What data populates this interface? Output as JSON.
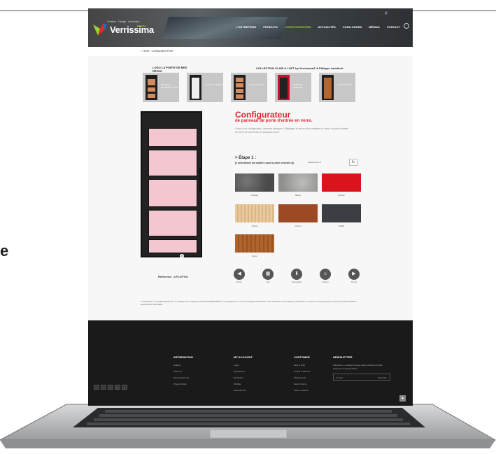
{
  "page_edge_letter": "e",
  "header": {
    "logo_text": "Verrissima",
    "logo_tagline": "Création · Design · Innovation",
    "logo_badge": "Exclusive",
    "nav": [
      "L'ENTREPRISE",
      "PRODUITS",
      "CONFIGURATEURS",
      "ACTUALITÉS",
      "CATALOGUES",
      "MÉDIAS",
      "CONTACT"
    ],
    "active_nav": "CONFIGURATEURS"
  },
  "breadcrumb": {
    "home": "Home",
    "current": "Configurateur Porte"
  },
  "collections": {
    "left_title": "LOGO LA PORTE DE MES RÊVES",
    "right_title": "COLLECTION CLAIR & LOFT by Verrissima® & Philippe Labellerit",
    "items": [
      {
        "label": "Collection ELYSÉES STYLE"
      },
      {
        "label": "Collection ALBION"
      },
      {
        "label": "Collection LOFT"
      },
      {
        "label": "Collection GRAPHIK"
      },
      {
        "label": "Collection LOFT"
      }
    ]
  },
  "configurator": {
    "title": "Configurateur",
    "subtitle": "de panneau de porte d'entrée en verre.",
    "description": "Grâce à ce configurateur, devenez designer ! Mélangez le verre et les matières et créez la porte d'entrée en verre de vos rêves en quelques clics !",
    "step_title": "> Étape 1 :",
    "step_subtitle": "je sélectionne ma matière pour la zone centrale (A)",
    "step_selector": "Sélectionner ▾",
    "reference": "Référence : LPLOFT01",
    "door_marker": "A"
  },
  "swatches": [
    {
      "label": "Ardoise",
      "color": "#5c5c5c"
    },
    {
      "label": "Béton",
      "color": "#a3a3a0"
    },
    {
      "label": "Carmin",
      "color": "#d9141c"
    },
    {
      "label": "Chêne",
      "color": "#e8caa0"
    },
    {
      "label": "Corten",
      "color": "#9b4a24"
    },
    {
      "label": "Gabbi",
      "color": "#3b3f43"
    },
    {
      "label": "Noyer",
      "color": "#b0642c"
    }
  ],
  "tools": [
    {
      "label": "Retour",
      "glyph": "◀"
    },
    {
      "label": "Vitre",
      "glyph": "▦"
    },
    {
      "label": "Sauvegarder",
      "glyph": "⬇"
    },
    {
      "label": "Imprimer",
      "glyph": "⌂"
    },
    {
      "label": "Suivant",
      "glyph": "▶"
    }
  ],
  "legal": "© COPYRIGHT : Les produits figurant dans ce catalogue sont la propriété exclusive de VERRISSIMA®, ils sont protégés par le Code de la Propriété Intellectuelle. Toute reproduction, même partielle, est interdite. Les couleurs et textures présentées sont données à titre indicatif et peuvent différer de la réalité.",
  "footer": {
    "information": {
      "title": "INFORMATION",
      "links": [
        "Delivery",
        "About Us",
        "Secure Payment",
        "Privacy Policy"
      ]
    },
    "account": {
      "title": "MY ACCOUNT",
      "links": [
        "Login",
        "My Account",
        "My Orders",
        "Wishlist",
        "Personal Info"
      ]
    },
    "customer": {
      "title": "CUSTOMER",
      "links": [
        "Help & FAQ",
        "Orders & Returns",
        "Shipping Info",
        "Search Terms",
        "Store Locations"
      ]
    },
    "newsletter": {
      "title": "NEWSLETTER",
      "description": "Subscribe to mailing list & get latest products arrivals, discounts & special offers!",
      "placeholder": "E-mail",
      "button": "Subscribe"
    },
    "socials": [
      "f",
      "t",
      "in",
      "g+",
      "p"
    ]
  },
  "scroll_top_glyph": "▲"
}
